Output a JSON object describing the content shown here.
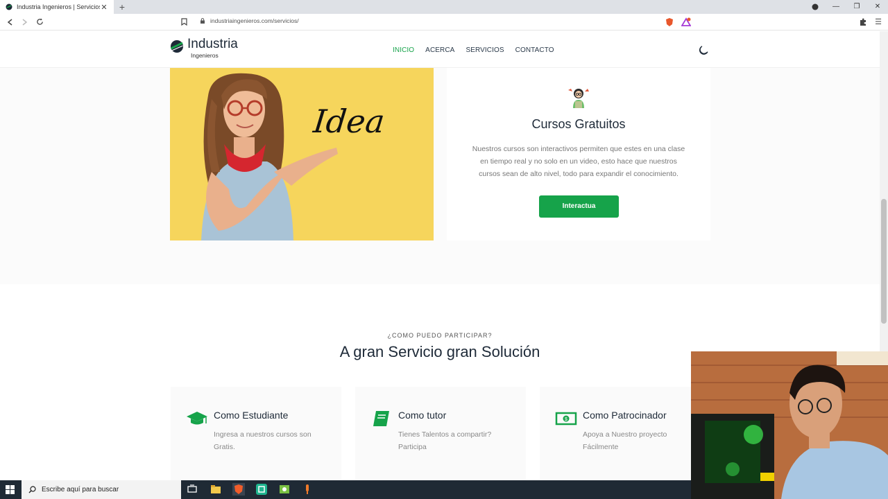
{
  "browser": {
    "tab_title": "Industria Ingenieros | Servicios",
    "tab_close": "✕",
    "new_tab": "+",
    "url": "industriaingenieros.com/servicios/"
  },
  "header": {
    "brand": "Industria",
    "brand_sub": "Ingenieros",
    "nav": [
      {
        "label": "INICIO",
        "active": true
      },
      {
        "label": "ACERCA",
        "active": false
      },
      {
        "label": "SERVICIOS",
        "active": false
      },
      {
        "label": "CONTACTO",
        "active": false
      }
    ]
  },
  "hero": {
    "image_word": "Idea",
    "card_title": "Cursos Gratuitos",
    "card_text": "Nuestros cursos son interactivos permiten que estes en una clase en tiempo real y no solo en un video, esto hace que nuestros cursos sean de alto nivel, todo para expandir el conocimiento.",
    "cta_label": "Interactua"
  },
  "services": {
    "eyebrow": "¿COMO PUEDO PARTICIPAR?",
    "title": "A gran Servicio gran Solución",
    "items": [
      {
        "title": "Como Estudiante",
        "text": "Ingresa a nuestros cursos son Gratis.",
        "icon": "graduation-cap-icon"
      },
      {
        "title": "Como tutor",
        "text": "Tienes Talentos a compartir? Participa",
        "icon": "book-icon"
      },
      {
        "title": "Como Patrocinador",
        "text": "Apoya a Nuestro proyecto Fácilmente",
        "icon": "money-icon"
      }
    ]
  },
  "taskbar": {
    "search_placeholder": "Escribe aquí para buscar"
  },
  "colors": {
    "accent": "#16a34a",
    "text_dark": "#1e2a38",
    "image_bg": "#f6d55c"
  }
}
